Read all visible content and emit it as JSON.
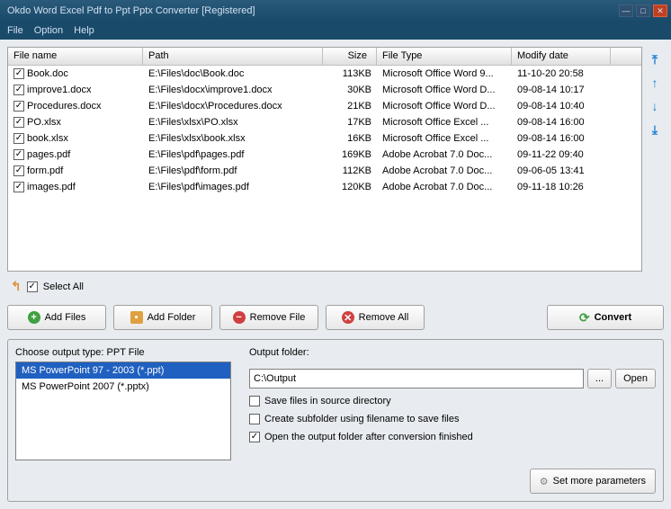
{
  "title": "Okdo Word Excel Pdf to Ppt Pptx Converter [Registered]",
  "menu": {
    "file": "File",
    "option": "Option",
    "help": "Help"
  },
  "columns": {
    "name": "File name",
    "path": "Path",
    "size": "Size",
    "type": "File Type",
    "date": "Modify date"
  },
  "files": [
    {
      "name": "Book.doc",
      "path": "E:\\Files\\doc\\Book.doc",
      "size": "113KB",
      "type": "Microsoft Office Word 9...",
      "date": "11-10-20 20:58"
    },
    {
      "name": "improve1.docx",
      "path": "E:\\Files\\docx\\improve1.docx",
      "size": "30KB",
      "type": "Microsoft Office Word D...",
      "date": "09-08-14 10:17"
    },
    {
      "name": "Procedures.docx",
      "path": "E:\\Files\\docx\\Procedures.docx",
      "size": "21KB",
      "type": "Microsoft Office Word D...",
      "date": "09-08-14 10:40"
    },
    {
      "name": "PO.xlsx",
      "path": "E:\\Files\\xlsx\\PO.xlsx",
      "size": "17KB",
      "type": "Microsoft Office Excel ...",
      "date": "09-08-14 16:00"
    },
    {
      "name": "book.xlsx",
      "path": "E:\\Files\\xlsx\\book.xlsx",
      "size": "16KB",
      "type": "Microsoft Office Excel ...",
      "date": "09-08-14 16:00"
    },
    {
      "name": "pages.pdf",
      "path": "E:\\Files\\pdf\\pages.pdf",
      "size": "169KB",
      "type": "Adobe Acrobat 7.0 Doc...",
      "date": "09-11-22 09:40"
    },
    {
      "name": "form.pdf",
      "path": "E:\\Files\\pdf\\form.pdf",
      "size": "112KB",
      "type": "Adobe Acrobat 7.0 Doc...",
      "date": "09-06-05 13:41"
    },
    {
      "name": "images.pdf",
      "path": "E:\\Files\\pdf\\images.pdf",
      "size": "120KB",
      "type": "Adobe Acrobat 7.0 Doc...",
      "date": "09-11-18 10:26"
    }
  ],
  "selectAll": "Select All",
  "buttons": {
    "addFiles": "Add Files",
    "addFolder": "Add Folder",
    "removeFile": "Remove File",
    "removeAll": "Remove All",
    "convert": "Convert"
  },
  "outputType": {
    "label": "Choose output type:",
    "current": "PPT File",
    "options": [
      "MS PowerPoint 97 - 2003 (*.ppt)",
      "MS PowerPoint 2007 (*.pptx)"
    ]
  },
  "outputFolder": {
    "label": "Output folder:",
    "value": "C:\\Output",
    "browse": "...",
    "open": "Open"
  },
  "checks": {
    "saveInSource": "Save files in source directory",
    "createSubfolder": "Create subfolder using filename to save files",
    "openAfter": "Open the output folder after conversion finished"
  },
  "moreParams": "Set more parameters"
}
